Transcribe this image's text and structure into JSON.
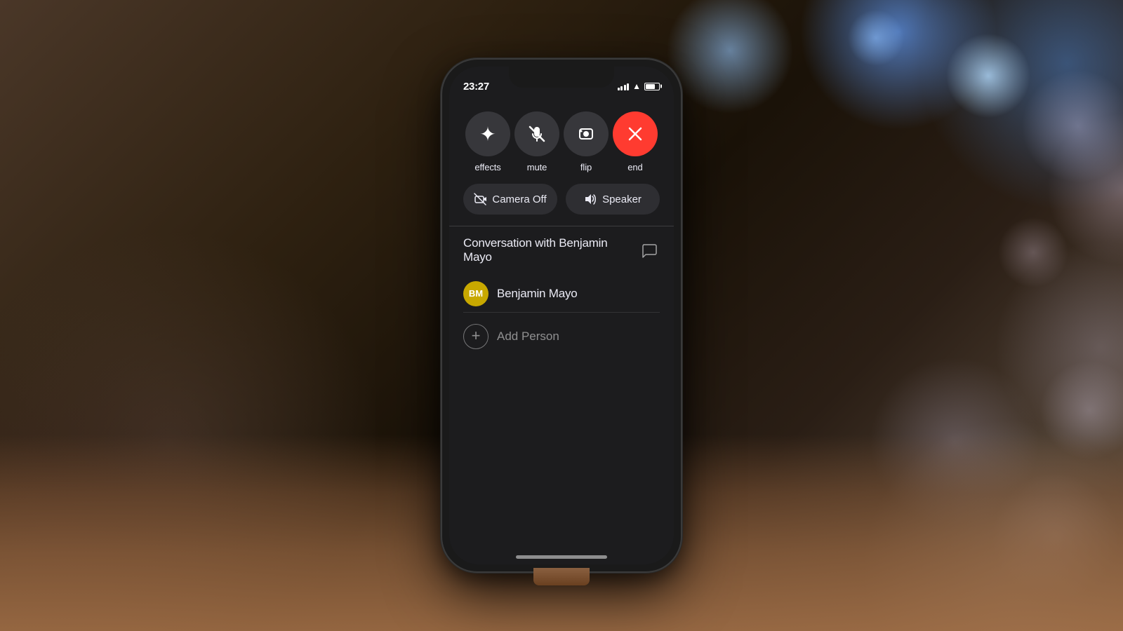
{
  "background": {
    "description": "Bokeh photography background with dark wooden table"
  },
  "phone": {
    "status_bar": {
      "time": "23:27",
      "time_arrow": "▶",
      "signal": "signal",
      "wifi": "wifi",
      "battery": "battery"
    },
    "call_controls": {
      "buttons": [
        {
          "id": "effects",
          "icon": "✦",
          "label": "effects"
        },
        {
          "id": "mute",
          "icon": "🎤",
          "label": "mute"
        },
        {
          "id": "flip",
          "icon": "📷",
          "label": "flip"
        },
        {
          "id": "end",
          "icon": "✕",
          "label": "end",
          "color": "#ff3b30"
        }
      ],
      "toggle_buttons": [
        {
          "id": "camera_off",
          "icon": "📹",
          "label": "Camera Off"
        },
        {
          "id": "speaker",
          "icon": "🔊",
          "label": "Speaker"
        }
      ]
    },
    "conversation": {
      "title": "Conversation with Benjamin Mayo",
      "contact": {
        "initials": "BM",
        "name": "Benjamin Mayo",
        "avatar_color": "#c8a800"
      },
      "add_person_label": "Add Person"
    },
    "home_indicator": true
  }
}
